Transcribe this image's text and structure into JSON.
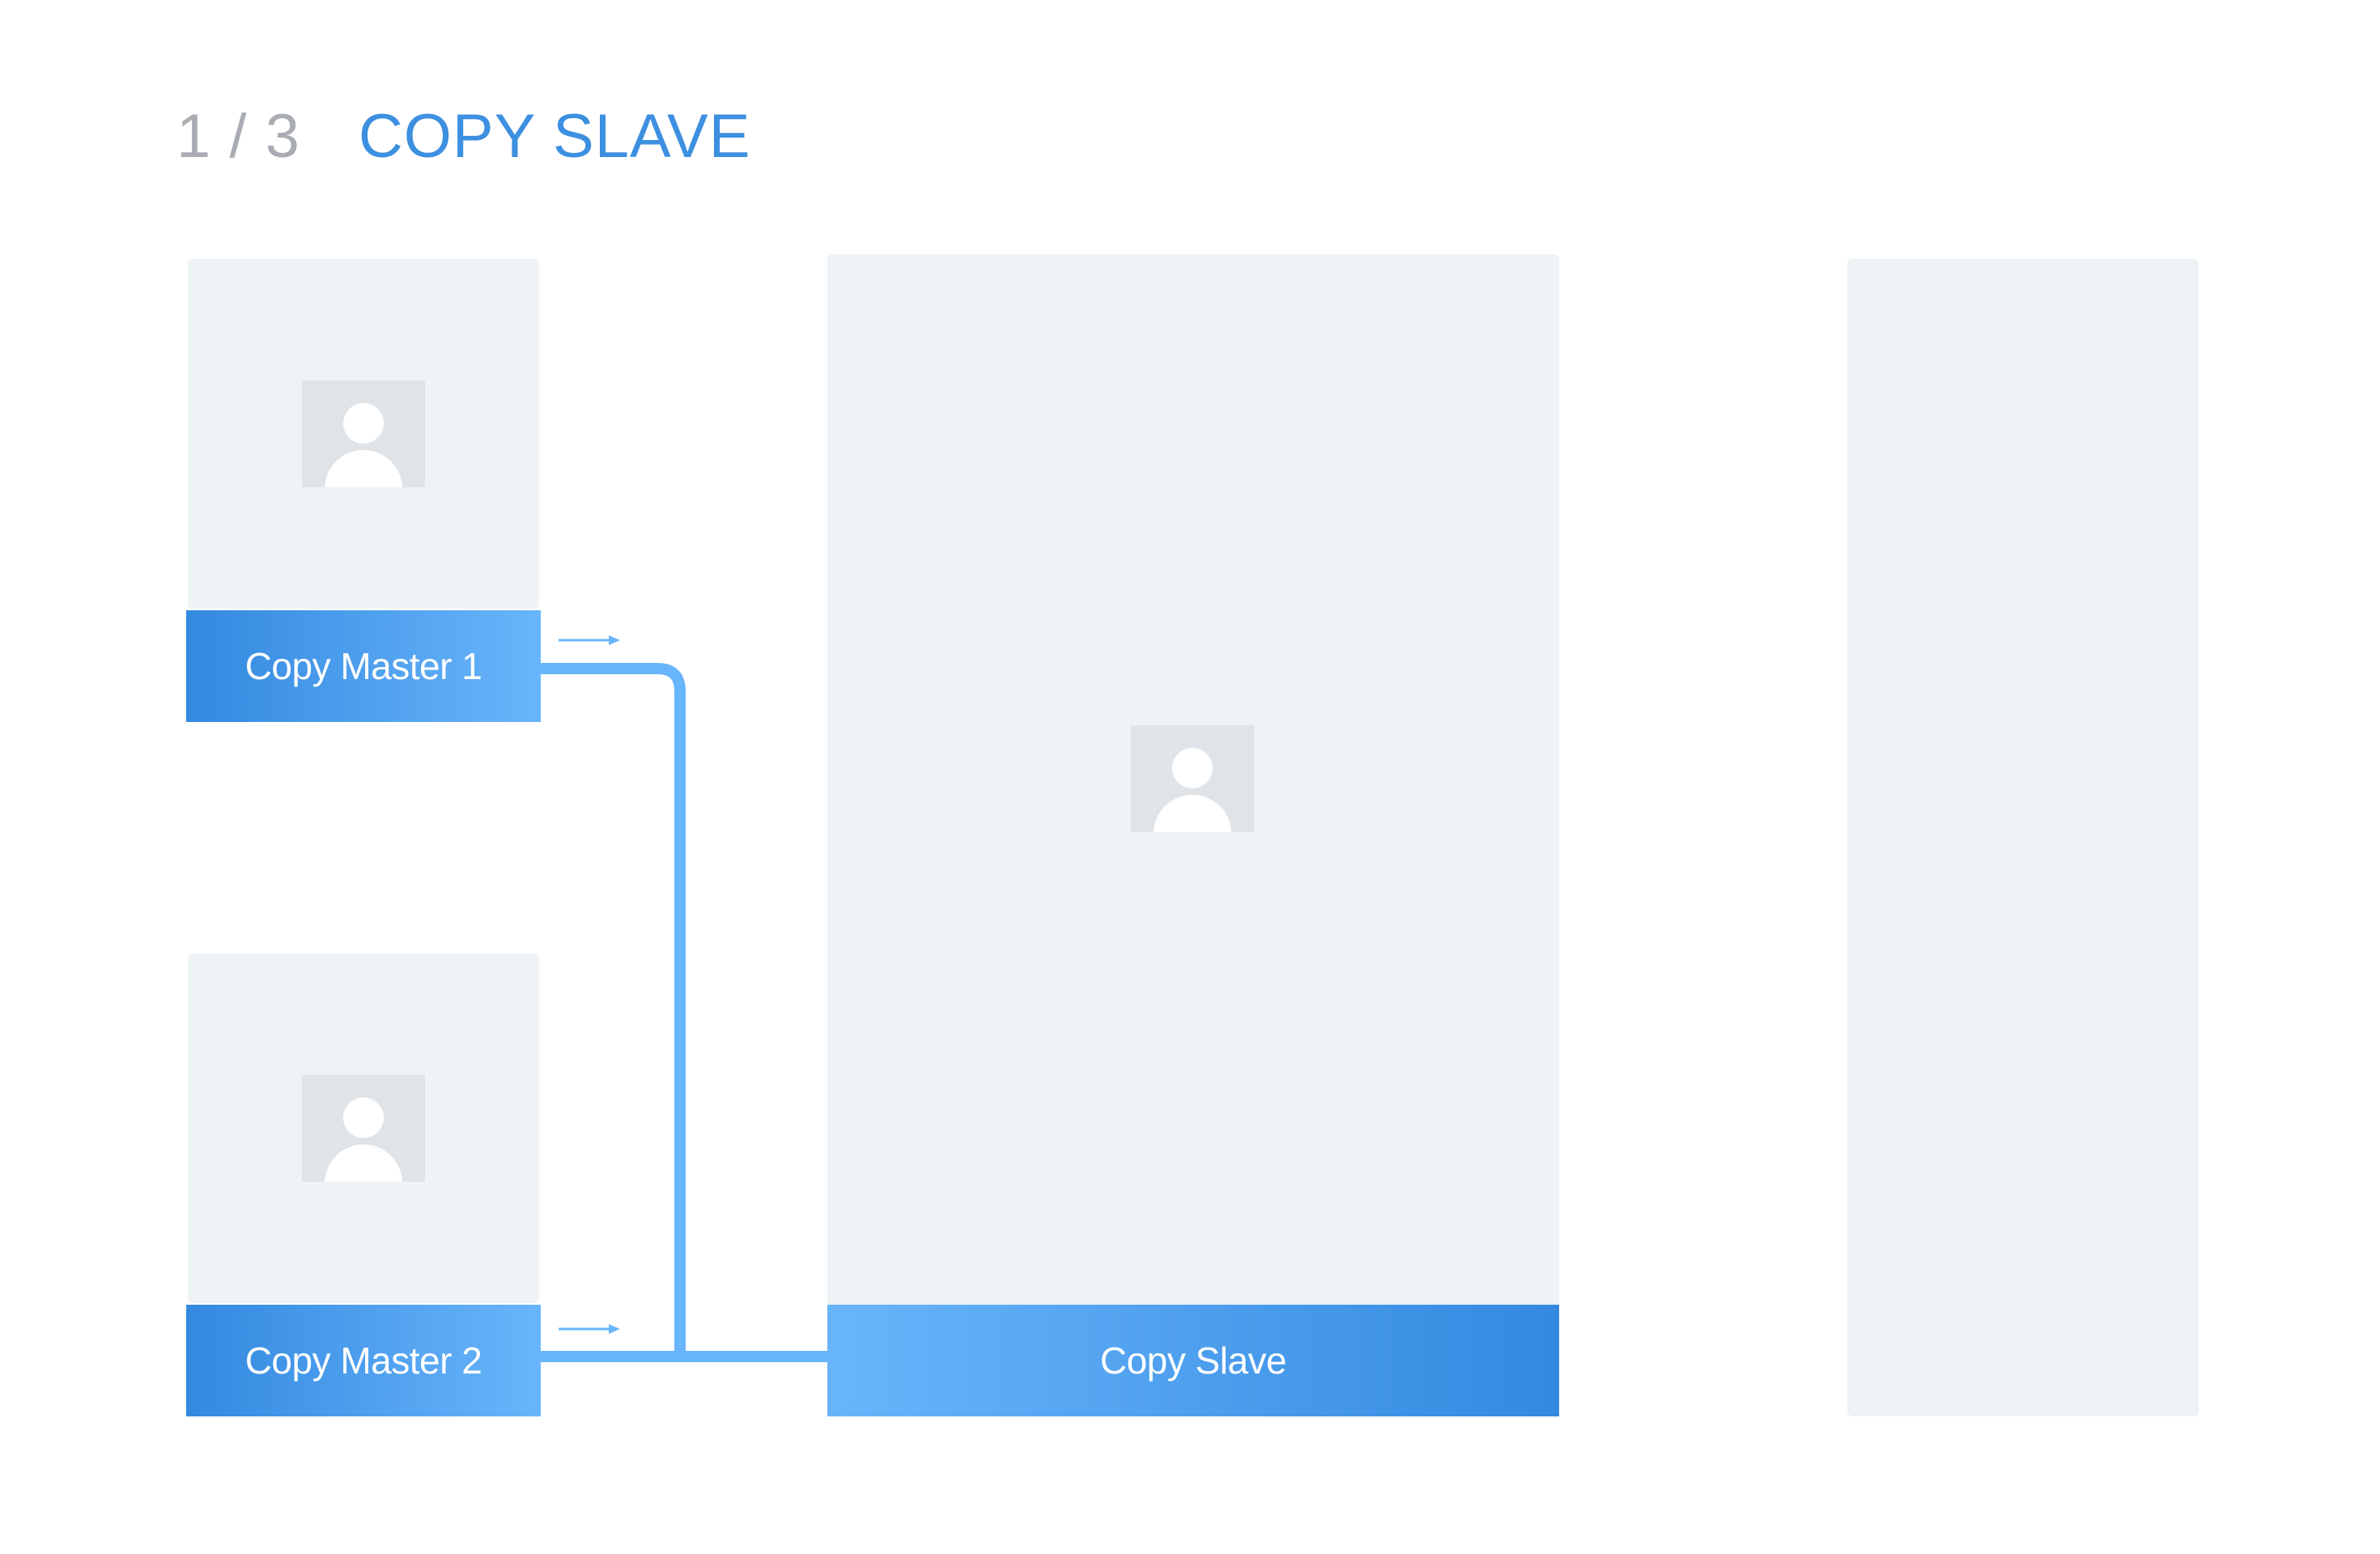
{
  "header": {
    "step": "1 / 3",
    "title": "COPY SLAVE"
  },
  "nodes": {
    "master_1": {
      "label": "Copy Master 1"
    },
    "master_2": {
      "label": "Copy Master 2"
    },
    "slave": {
      "label": "Copy Slave"
    }
  },
  "icons": {
    "avatar": "user-placeholder-icon",
    "arrow": "arrow-right-icon"
  },
  "colors": {
    "accent": "#3d8fe0",
    "connector": "#69b5fb",
    "gradient_dark": "#3389e0",
    "gradient_light": "#69b5fb",
    "panel": "#eef3f6",
    "avatar_bg": "#dfe4e8",
    "muted_text": "#a9adb3"
  }
}
